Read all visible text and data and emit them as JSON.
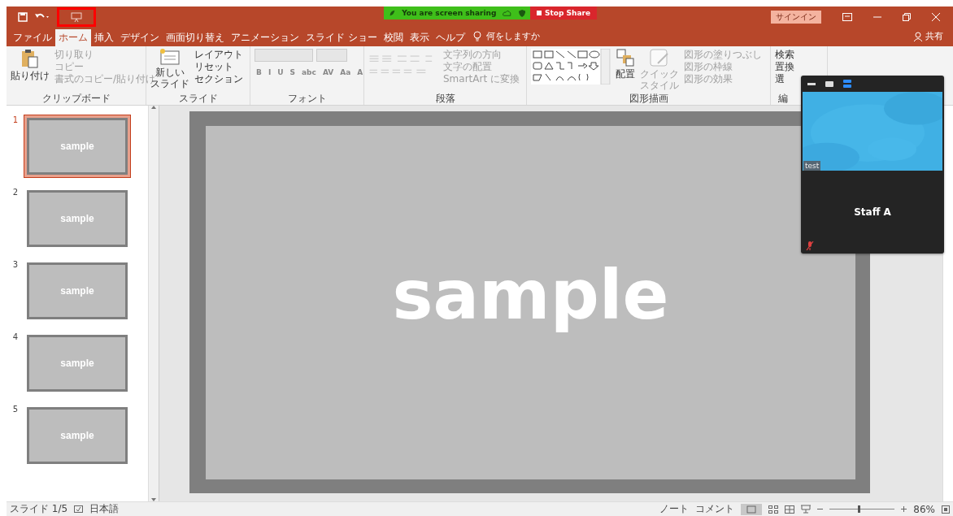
{
  "share_bar": {
    "status": "You are screen sharing",
    "stop_button": "Stop Share"
  },
  "title_bar": {
    "sign_in": "サインイン"
  },
  "tabs": [
    {
      "label": "ファイル",
      "selected": false
    },
    {
      "label": "ホーム",
      "selected": true
    },
    {
      "label": "挿入",
      "selected": false
    },
    {
      "label": "デザイン",
      "selected": false
    },
    {
      "label": "画面切り替え",
      "selected": false
    },
    {
      "label": "アニメーション",
      "selected": false
    },
    {
      "label": "スライド ショー",
      "selected": false
    },
    {
      "label": "校閲",
      "selected": false
    },
    {
      "label": "表示",
      "selected": false
    },
    {
      "label": "ヘルプ",
      "selected": false
    }
  ],
  "tell_me": "何をしますか",
  "share": "共有",
  "ribbon": {
    "clipboard": {
      "paste": "貼り付け",
      "cut": "切り取り",
      "copy": "コピー",
      "format_painter": "書式のコピー/貼り付け",
      "label": "クリップボード"
    },
    "slides": {
      "new_slide_1": "新しい",
      "new_slide_2": "スライド",
      "layout": "レイアウト",
      "reset": "リセット",
      "section": "セクション",
      "label": "スライド"
    },
    "font": {
      "buttons": [
        "B",
        "I",
        "U",
        "S",
        "abc",
        "AV",
        "Aa",
        "A"
      ],
      "label": "フォント"
    },
    "paragraph": {
      "text_direction": "文字列の方向",
      "align_text": "文字の配置",
      "smartart": "SmartArt に変換",
      "label": "段落"
    },
    "drawing": {
      "arrange": "配置",
      "quick_styles_1": "クイック",
      "quick_styles_2": "スタイル",
      "fill": "図形の塗りつぶし",
      "outline": "図形の枠線",
      "effects": "図形の効果",
      "label": "図形描画"
    },
    "editing": {
      "find": "検索",
      "replace": "置換",
      "select": "選",
      "label": "編"
    }
  },
  "slides": [
    {
      "number": "1",
      "title": "sample",
      "selected": true
    },
    {
      "number": "2",
      "title": "sample",
      "selected": false
    },
    {
      "number": "3",
      "title": "sample",
      "selected": false
    },
    {
      "number": "4",
      "title": "sample",
      "selected": false
    },
    {
      "number": "5",
      "title": "sample",
      "selected": false
    }
  ],
  "current_slide": {
    "title": "sample"
  },
  "video_panel": {
    "tag": "test",
    "participant": "Staff A",
    "muted": true
  },
  "status_bar": {
    "slide_count": "スライド 1/5",
    "language": "日本語",
    "notes": "ノート",
    "comments": "コメント",
    "zoom": {
      "level": 0.45,
      "reading": "86%"
    }
  }
}
